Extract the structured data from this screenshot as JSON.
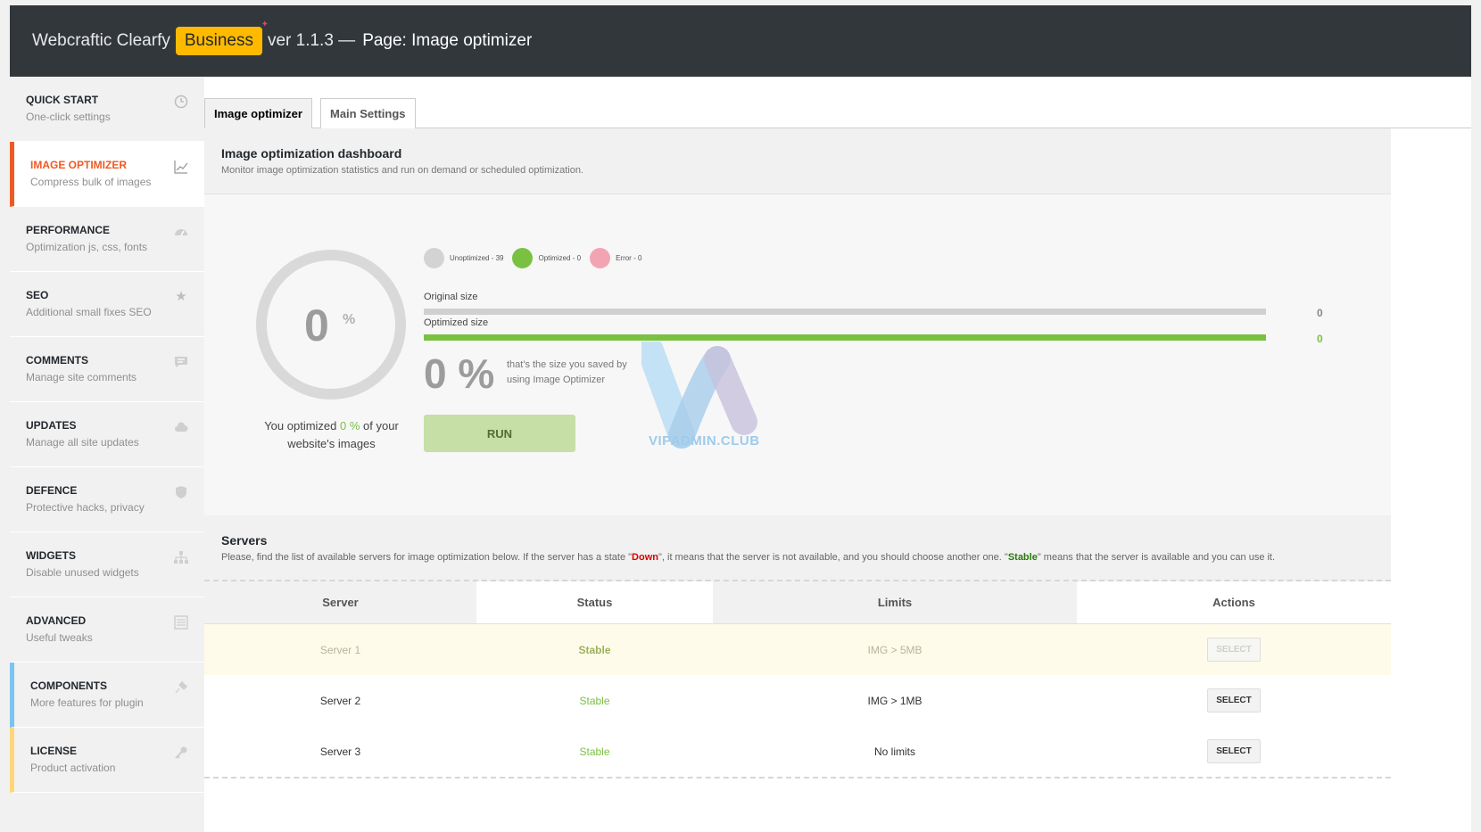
{
  "header": {
    "brand": "Webcraftic Clearfy",
    "badge": "Business",
    "version": "ver 1.1.3 —",
    "page": "Page: Image optimizer"
  },
  "sidebar": {
    "items": [
      {
        "title": "QUICK START",
        "sub": "One-click settings",
        "icon": "clock-icon"
      },
      {
        "title": "IMAGE OPTIMIZER",
        "sub": "Compress bulk of images",
        "icon": "chart-icon"
      },
      {
        "title": "PERFORMANCE",
        "sub": "Optimization js, css, fonts",
        "icon": "dashboard-icon"
      },
      {
        "title": "SEO",
        "sub": "Additional small fixes SEO",
        "icon": "star-icon"
      },
      {
        "title": "COMMENTS",
        "sub": "Manage site comments",
        "icon": "comment-icon"
      },
      {
        "title": "UPDATES",
        "sub": "Manage all site updates",
        "icon": "cloud-icon"
      },
      {
        "title": "DEFENCE",
        "sub": "Protective hacks, privacy",
        "icon": "shield-icon"
      },
      {
        "title": "WIDGETS",
        "sub": "Disable unused widgets",
        "icon": "sitemap-icon"
      },
      {
        "title": "ADVANCED",
        "sub": "Useful tweaks",
        "icon": "list-icon"
      },
      {
        "title": "COMPONENTS",
        "sub": "More features for plugin",
        "icon": "plugin-icon"
      },
      {
        "title": "LICENSE",
        "sub": "Product activation",
        "icon": "key-icon"
      }
    ]
  },
  "tabs": [
    "Image optimizer",
    "Main Settings"
  ],
  "dashboard": {
    "title": "Image optimization dashboard",
    "desc": "Monitor image optimization statistics and run on demand or scheduled optimization.",
    "ring_value": "0",
    "ring_unit": "%",
    "caption_pre": "You optimized",
    "caption_value": "0 %",
    "caption_post": "of your website's images",
    "legend": [
      {
        "label": "Unoptimized - 39",
        "color": "#d3d3d3"
      },
      {
        "label": "Optimized - 0",
        "color": "#7ac142"
      },
      {
        "label": "Error - 0",
        "color": "#f3a4b2"
      }
    ],
    "original_label": "Original size",
    "original_value": "0",
    "optimized_label": "Optimized size",
    "optimized_value": "0",
    "saved_pct": "0 %",
    "saved_text": "that's the size you saved by using Image Optimizer",
    "run_label": "RUN",
    "watermark": "VIPADMIN.CLUB"
  },
  "servers": {
    "title": "Servers",
    "desc_1": "Please, find the list of available servers for image optimization below. If the server has a state \"",
    "down": "Down",
    "desc_2": "\", it means that the server is not available, and you should choose another one. \"",
    "stable": "Stable",
    "desc_3": "\" means that the server is available and you can use it.",
    "columns": [
      "Server",
      "Status",
      "Limits",
      "Actions"
    ],
    "rows": [
      {
        "server": "Server 1",
        "status": "Stable",
        "limits": "IMG > 5MB",
        "action": "SELECT"
      },
      {
        "server": "Server 2",
        "status": "Stable",
        "limits": "IMG > 1MB",
        "action": "SELECT"
      },
      {
        "server": "Server 3",
        "status": "Stable",
        "limits": "No limits",
        "action": "SELECT"
      }
    ]
  }
}
